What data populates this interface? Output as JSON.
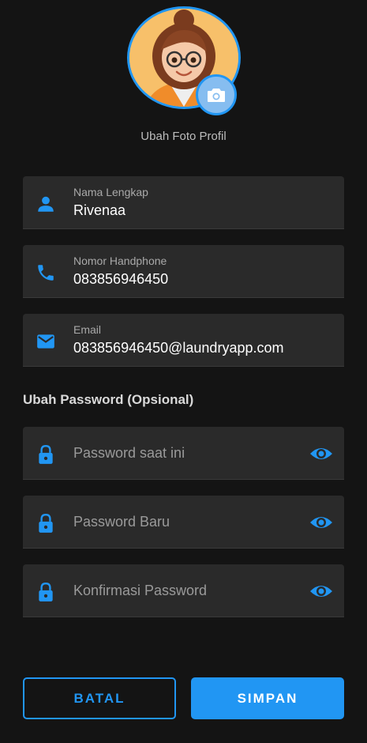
{
  "profile": {
    "change_photo_label": "Ubah Foto Profil"
  },
  "fields": {
    "full_name": {
      "label": "Nama Lengkap",
      "value": "Rivenaa",
      "icon": "person-icon"
    },
    "phone": {
      "label": "Nomor Handphone",
      "value": "083856946450",
      "icon": "phone-icon"
    },
    "email": {
      "label": "Email",
      "value": "083856946450@laundryapp.com",
      "icon": "email-icon"
    }
  },
  "password_section": {
    "title": "Ubah Password (Opsional)",
    "current_placeholder": "Password saat ini",
    "new_placeholder": "Password Baru",
    "confirm_placeholder": "Konfirmasi Password"
  },
  "actions": {
    "cancel_label": "BATAL",
    "save_label": "SIMPAN"
  },
  "colors": {
    "accent": "#2196f3",
    "background": "#141414",
    "field_background": "#2a2a2a"
  }
}
